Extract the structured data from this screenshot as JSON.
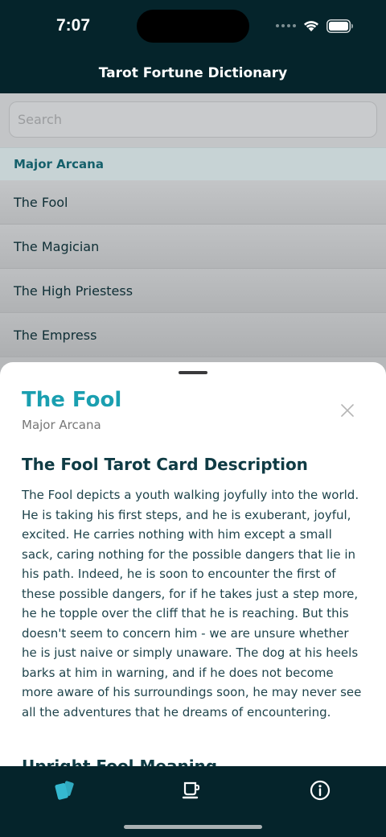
{
  "status": {
    "time": "7:07"
  },
  "nav": {
    "title": "Tarot Fortune Dictionary"
  },
  "search": {
    "placeholder": "Search",
    "value": ""
  },
  "list": {
    "section": "Major Arcana",
    "items": [
      "The Fool",
      "The Magician",
      "The High Priestess",
      "The Empress"
    ]
  },
  "sheet": {
    "title": "The Fool",
    "subtitle": "Major Arcana",
    "description_heading": "The Fool Tarot Card Description",
    "description": "The Fool depicts a youth walking joyfully into the world. He is taking his first steps, and he is exuberant, joyful, excited. He carries nothing with him except a small sack, caring nothing for the possible dangers that lie in his path. Indeed, he is soon to encounter the first of these possible dangers, for if he takes just a step more, he he topple over the cliff that he is reaching. But this doesn't seem to concern him - we are unsure whether he is just naive or simply unaware. The dog at his heels barks at him in warning, and if he does not become more aware of his surroundings soon, he may never see all the adventures that he dreams of encountering.",
    "next_heading": "Upright Fool Meaning"
  },
  "tabs": [
    {
      "name": "cards",
      "icon": "cards-icon",
      "active": true
    },
    {
      "name": "cup",
      "icon": "cup-icon",
      "active": false
    },
    {
      "name": "info",
      "icon": "info-icon",
      "active": false
    }
  ],
  "colors": {
    "brand_dark": "#05242b",
    "accent": "#1a9fb0",
    "active_tab": "#35b9d0",
    "section_text": "#15606b"
  }
}
